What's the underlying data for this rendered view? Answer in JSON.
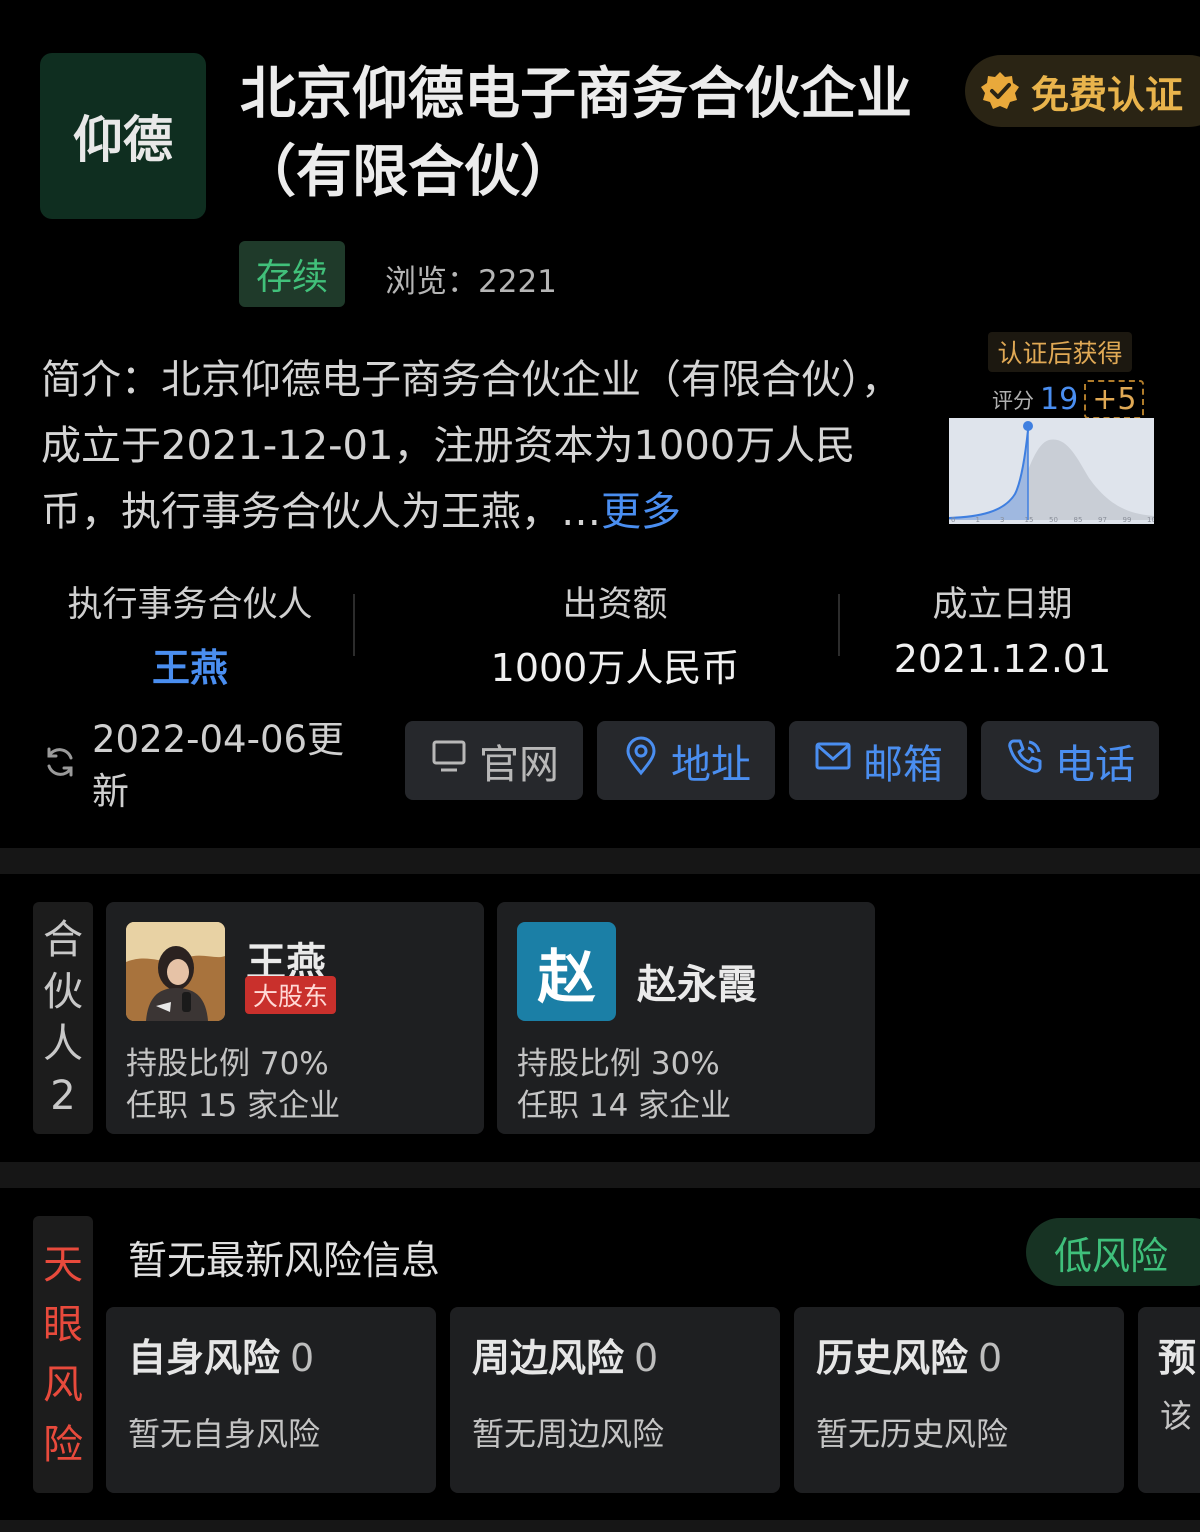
{
  "company": {
    "logo_text": "仰德",
    "name": "北京仰德电子商务合伙企业（有限合伙）",
    "verify_label": "免费认证",
    "status": "存续",
    "views": "浏览：2221"
  },
  "intro": {
    "text": "简介：北京仰德电子商务合伙企业（有限合伙），成立于2021-12-01，注册资本为1000万人民币，执行事务合伙人为王燕，…",
    "more": "更多"
  },
  "score": {
    "gain_label": "认证后获得",
    "score_label": "评分",
    "score_value": "19",
    "plus": "+5",
    "curve_ticks": [
      "0",
      "1",
      "3",
      "15",
      "50",
      "85",
      "97",
      "99",
      "100"
    ],
    "current_tick": "15"
  },
  "stats": [
    {
      "label": "执行事务合伙人",
      "value": "王燕"
    },
    {
      "label": "出资额",
      "value": "1000万人民币"
    },
    {
      "label": "成立日期",
      "value": "2021.12.01"
    }
  ],
  "updated": "2022-04-06更新",
  "actions": [
    {
      "label": "官网",
      "icon": "monitor-icon"
    },
    {
      "label": "地址",
      "icon": "location-pin-icon"
    },
    {
      "label": "邮箱",
      "icon": "mail-icon"
    },
    {
      "label": "电话",
      "icon": "phone-icon"
    }
  ],
  "partners": {
    "side_label": [
      "合",
      "伙",
      "人",
      "2"
    ],
    "items": [
      {
        "name": "王燕",
        "tag": "大股东",
        "share": "持股比例 70%",
        "jobs": "任职 15 家企业"
      },
      {
        "name": "赵永霞",
        "avatar_letter": "赵",
        "share": "持股比例 30%",
        "jobs": "任职 14 家企业"
      }
    ]
  },
  "risk": {
    "side_label": [
      "天",
      "眼",
      "风",
      "险"
    ],
    "title": "暂无最新风险信息",
    "level": "低风险",
    "cards": [
      {
        "title": "自身风险",
        "count": "0",
        "desc": "暂无自身风险"
      },
      {
        "title": "周边风险",
        "count": "0",
        "desc": "暂无周边风险"
      },
      {
        "title": "历史风险",
        "count": "0",
        "desc": "暂无历史风险"
      },
      {
        "title": "预",
        "desc": "该 甄"
      }
    ]
  },
  "colors": {
    "background": "#000000",
    "card": "#1e1f21",
    "link_blue": "#4a8ef0",
    "gold": "#e9b44c",
    "green": "#41c07a",
    "red": "#e84a3c"
  }
}
